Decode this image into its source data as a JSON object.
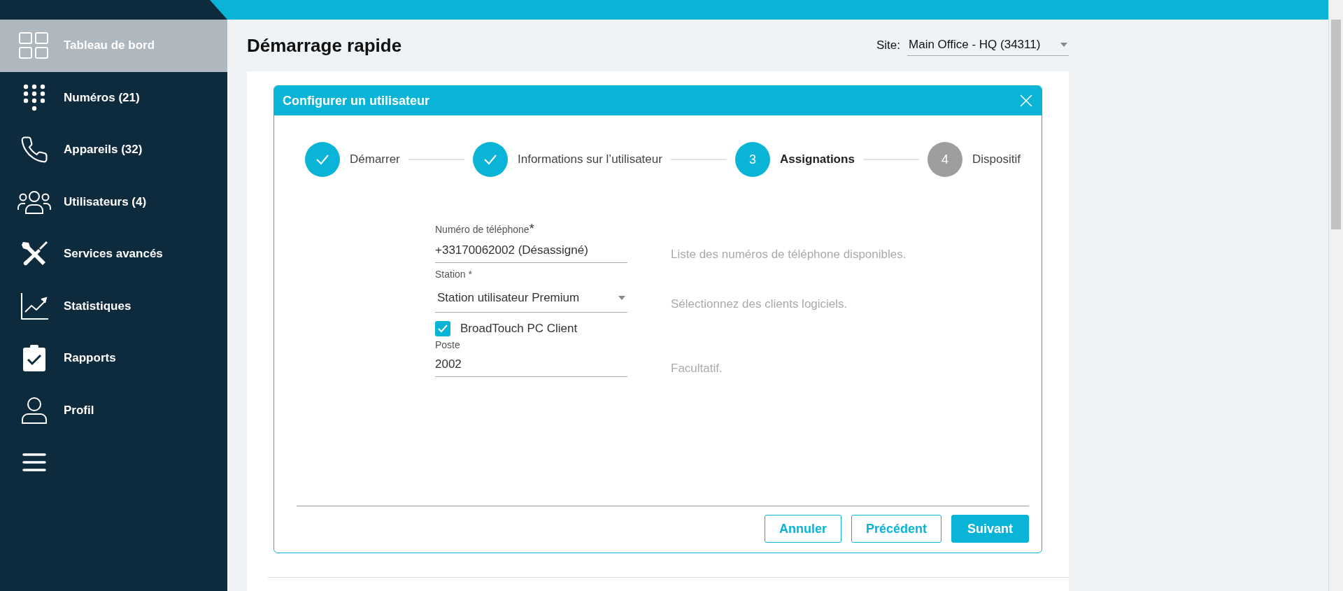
{
  "sidebar": {
    "items": [
      {
        "label": "Tableau de bord",
        "selected": true
      },
      {
        "label": "Numéros (21)",
        "selected": false
      },
      {
        "label": "Appareils (32)",
        "selected": false
      },
      {
        "label": "Utilisateurs (4)",
        "selected": false
      },
      {
        "label": "Services avancés",
        "selected": false
      },
      {
        "label": "Statistiques",
        "selected": false
      },
      {
        "label": "Rapports",
        "selected": false
      },
      {
        "label": "Profil",
        "selected": false
      },
      {
        "selected": false
      }
    ]
  },
  "page": {
    "title": "Démarrage rapide",
    "site_label": "Site:",
    "site_value": "Main Office - HQ (34311)"
  },
  "dialog": {
    "title": "Configurer un utilisateur",
    "steps": [
      {
        "label": "Démarrer",
        "completed": true,
        "selected": false
      },
      {
        "label": "Informations sur l’utilisateur",
        "completed": true,
        "selected": false
      },
      {
        "number": "3",
        "label": "Assignations",
        "completed": false,
        "selected": true
      },
      {
        "number": "4",
        "label": "Dispositif",
        "completed": false,
        "selected": false
      }
    ],
    "fields": [
      {
        "kind": "text",
        "label": "Numéro de téléphone",
        "required_mark": "*",
        "value": "+33170062002 (Désassigné)",
        "help": "Liste des numéros de téléphone disponibles."
      },
      {
        "kind": "select",
        "label": "Station *",
        "value": "Station utilisateur Premium",
        "help": "Sélectionnez des clients logiciels."
      },
      {
        "kind": "checkbox",
        "label": "BroadTouch PC Client",
        "checked": true
      },
      {
        "kind": "text",
        "label": "Poste",
        "value": "2002",
        "help": "Facultatif."
      }
    ],
    "buttons": [
      {
        "label": "Annuler",
        "primary": false
      },
      {
        "label": "Précédent",
        "primary": false
      },
      {
        "label": "Suivant",
        "primary": true
      }
    ]
  }
}
